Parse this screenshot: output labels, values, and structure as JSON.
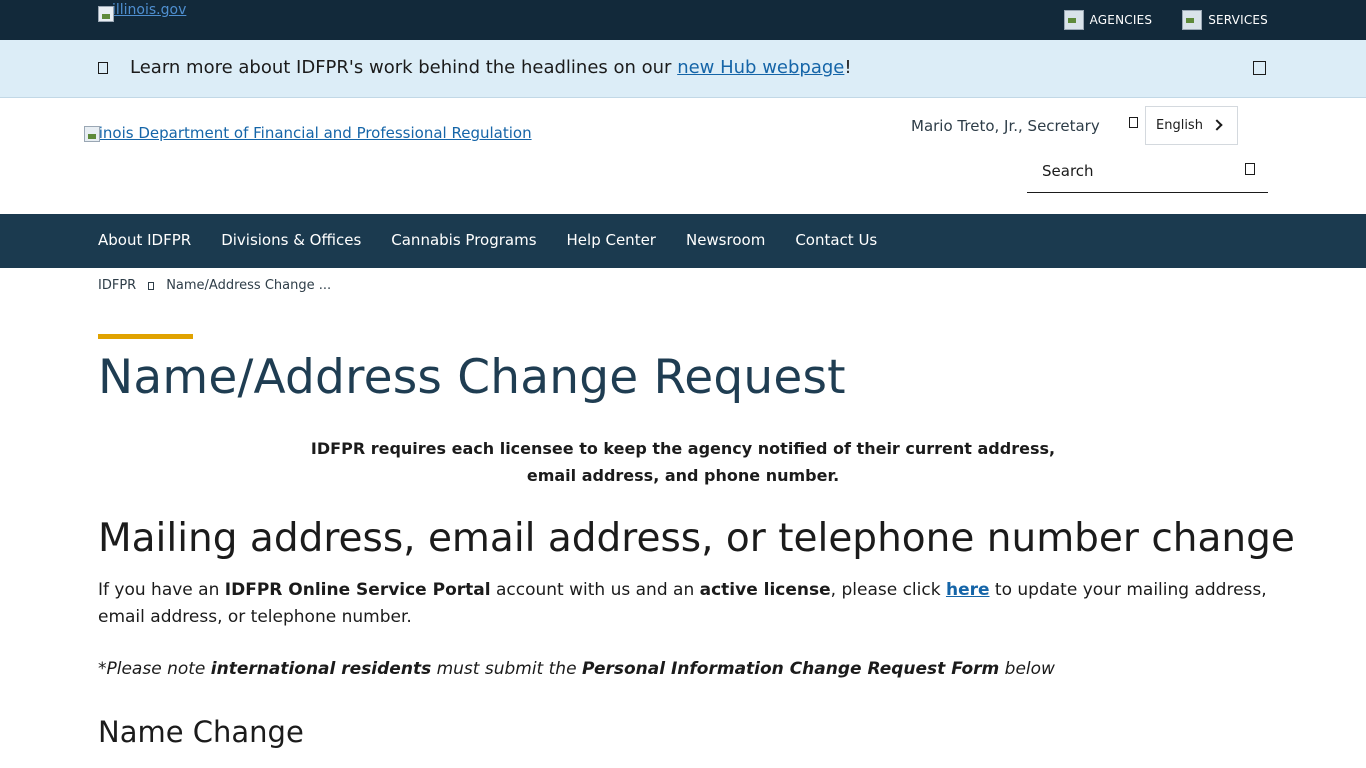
{
  "topbar": {
    "logo_alt": "illinois.gov",
    "links": [
      {
        "label": "AGENCIES",
        "icon": "agencies-icon"
      },
      {
        "label": "SERVICES",
        "icon": "services-icon"
      }
    ]
  },
  "alert": {
    "icon": "bell-icon",
    "text_before": "Learn more about IDFPR's work behind the headlines on our ",
    "link_text": "new Hub webpage",
    "text_after": "!",
    "close_icon": "close-icon"
  },
  "header": {
    "logo_alt": "Illinois Department of Financial and Professional Regulation",
    "secretary": "Mario Treto, Jr., Secretary",
    "language": "English",
    "search_placeholder": "Search"
  },
  "nav": {
    "items": [
      "About IDFPR",
      "Divisions & Offices",
      "Cannabis Programs",
      "Help Center",
      "Newsroom",
      "Contact Us"
    ]
  },
  "breadcrumb": {
    "items": [
      "IDFPR",
      "Name/Address Change ..."
    ]
  },
  "main": {
    "title": "Name/Address Change Request",
    "intro_line1": "IDFPR requires each licensee to keep the agency notified of their current address,",
    "intro_line2": "email address, and phone number.",
    "section1_heading": "Mailing address, email address, or telephone number change",
    "para": {
      "t1": "If you have an ",
      "b1": "IDFPR Online Service Portal",
      "t2": " account with us and an ",
      "b2": "active license",
      "t3": ", please click ",
      "link": "here",
      "t4": " to update your mailing address, email address, or telephone number."
    },
    "note": {
      "t1": "*Please note ",
      "b1": "international residents",
      "t2": " must submit the ",
      "b2": "Personal Information Change Request Form",
      "t3": " below"
    },
    "section2_heading": "Name Change"
  },
  "colors": {
    "topbar_bg": "#12293a",
    "alert_bg": "#dcedf7",
    "nav_bg": "#1b3a4f",
    "accent": "#e0a200",
    "link": "#1565a8",
    "title": "#1f3d52"
  }
}
